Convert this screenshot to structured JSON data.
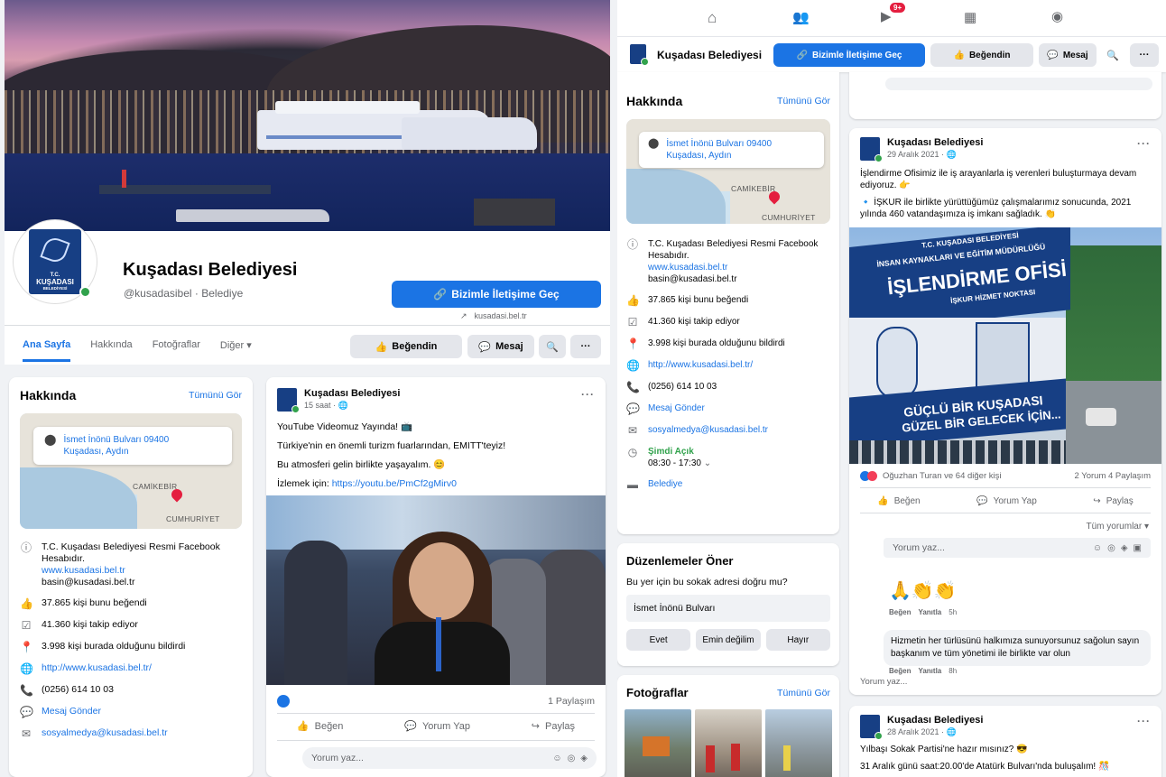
{
  "page": {
    "name": "Kuşadası Belediyesi",
    "handle": "@kusadasibel · Belediye",
    "logo_text": [
      "T.C.",
      "KUŞADASI",
      "BELEDİYESİ"
    ],
    "website_short": "kusadasi.bel.tr"
  },
  "buttons": {
    "contact": "Bizimle İletişime Geç",
    "liked": "Beğendin",
    "message": "Mesaj"
  },
  "tabs": [
    "Ana Sayfa",
    "Hakkında",
    "Fotoğraflar",
    "Diğer ▾"
  ],
  "topnav_badge": "9+",
  "about": {
    "title": "Hakkında",
    "see_all": "Tümünü Gör",
    "address_line1": "İsmet İnönü Bulvarı 09400",
    "address_line2": "Kuşadası, Aydın",
    "map_labels": [
      "CAMİKEBİR",
      "CUMHURİYET"
    ],
    "description": "T.C. Kuşadası Belediyesi Resmi Facebook Hesabıdır.",
    "website_link": "www.kusadasi.bel.tr",
    "email_text": "basin@kusadasi.bel.tr",
    "likes": "37.865 kişi bunu beğendi",
    "followers": "41.360 kişi takip ediyor",
    "checkins": "3.998 kişi burada olduğunu bildirdi",
    "url": "http://www.kusadasi.bel.tr/",
    "phone": "(0256) 614 10 03",
    "send_message": "Mesaj Gönder",
    "email_social": "sosyalmedya@kusadasi.bel.tr",
    "open_now": "Şimdi Açık",
    "hours": "08:30 - 17:30",
    "category": "Belediye"
  },
  "post1": {
    "author": "Kuşadası Belediyesi",
    "time": "15 saat · ",
    "lines": [
      "YouTube Videomuz Yayında! 📺",
      "Türkiye'nin en önemli turizm fuarlarından, EMITT'teyiz!",
      "Bu atmosferi gelin birlikte yaşayalım. 😊"
    ],
    "watch_prefix": "İzlemek için: ",
    "watch_link": "https://youtu.be/PmCf2gMirv0",
    "shares": "1 Paylaşım",
    "like": "Beğen",
    "comment": "Yorum Yap",
    "share": "Paylaş",
    "comment_placeholder": "Yorum yaz..."
  },
  "suggest": {
    "title": "Düzenlemeler Öner",
    "question": "Bu yer için bu sokak adresi doğru mu?",
    "value": "İsmet İnönü Bulvarı",
    "yes": "Evet",
    "unsure": "Emin değilim",
    "no": "Hayır"
  },
  "photos": {
    "title": "Fotoğraflar",
    "see_all": "Tümünü Gör"
  },
  "post2": {
    "author": "Kuşadası Belediyesi",
    "time": "29 Aralık 2021 · ",
    "line1": "İşlendirme Ofisimiz ile iş arayanlarla iş verenleri buluşturmaya devam ediyoruz. 👉",
    "line2": "🔹 İŞKUR ile birlikte yürüttüğümüz çalışmalarımız sonucunda, 2021 yılında 460 vatandaşımıza iş imkanı sağladık. 👏",
    "sign_top": "T.C. KUŞADASI BELEDİYESİ",
    "sign_sub": "İNSAN KAYNAKLARI VE EĞİTİM MÜDÜRLÜĞÜ",
    "sign_main": "İŞLENDİRME OFİSİ",
    "sign_iskur": "İŞKUR HİZMET NOKTASI",
    "banner1": "GÜÇLÜ BİR KUŞADASI",
    "banner2": "GÜZEL BİR GELECEK İÇİN...",
    "reactions": "Oğuzhan Turan ve 64 diğer kişi",
    "counts": "2 Yorum  4 Paylaşım",
    "like": "Beğen",
    "comment": "Yorum Yap",
    "share": "Paylaş",
    "all_comments": "Tüm yorumlar ▾",
    "comment_placeholder": "Yorum yaz...",
    "c1_emoji": "🙏👏👏",
    "c1_like": "Beğen",
    "c1_reply": "Yanıtla",
    "c1_time": "5h",
    "c2_text": "Hizmetin her türlüsünü halkımıza sunuyorsunuz sağolun sayın başkanım ve tüm yönetimi ile birlikte var olun",
    "c2_like": "Beğen",
    "c2_reply": "Yanıtla",
    "c2_time": "8h",
    "reply_placeholder": "Yorum yaz..."
  },
  "post3": {
    "author": "Kuşadası Belediyesi",
    "time": "28 Aralık 2021 · ",
    "line1": "Yılbaşı Sokak Partisi'ne hazır mısınız? 😎",
    "line2": "31 Aralık günü saat:20.00'de Atatürk Bulvarı'nda buluşalım! 🎊"
  }
}
